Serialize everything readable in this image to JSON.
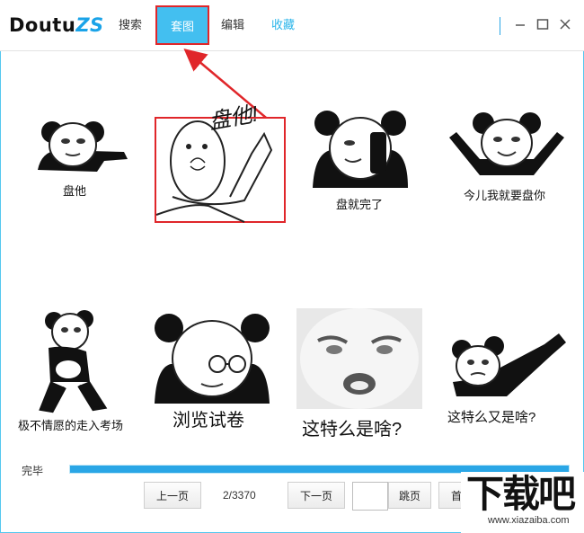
{
  "app": {
    "logo_main": "Doutu",
    "logo_accent": "ZS"
  },
  "nav": {
    "search": "搜索",
    "sets": "套图",
    "edit": "编辑",
    "favorites": "收藏"
  },
  "window": {
    "minimize_icon": "minimize-icon",
    "maximize_icon": "maximize-icon",
    "close_icon": "close-icon"
  },
  "grid": {
    "items": [
      {
        "caption": "盘他"
      },
      {
        "caption": "盘他!"
      },
      {
        "caption": "盘就完了"
      },
      {
        "caption": "今儿我就要盘你"
      },
      {
        "caption": "极不情愿的走入考场"
      },
      {
        "caption": "浏览试卷"
      },
      {
        "caption": "这特么是啥?"
      },
      {
        "caption": "这特么又是啥?"
      }
    ]
  },
  "status": {
    "text": "完毕",
    "progress_percent": 100
  },
  "pager": {
    "prev": "上一页",
    "page_info": "2/3370",
    "next": "下一页",
    "jump_value": "",
    "jump": "跳页",
    "first_partial": "首"
  },
  "watermark": {
    "big": "下载吧",
    "small": "www.xiazaiba.com"
  },
  "colors": {
    "accent": "#43bff0",
    "highlight_border": "#e0262a",
    "annotation_arrow": "#e0262a"
  }
}
